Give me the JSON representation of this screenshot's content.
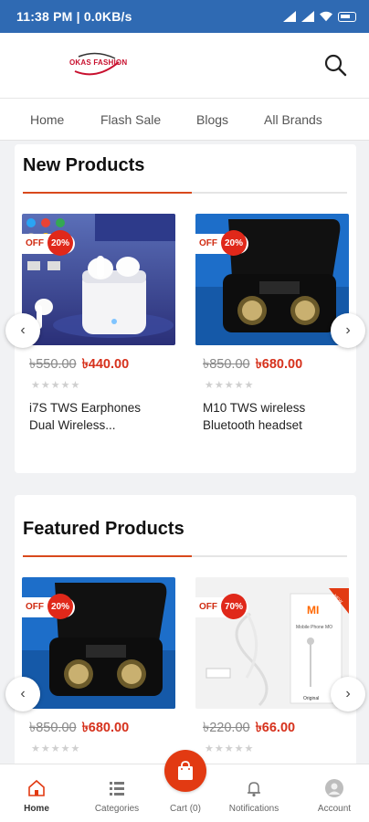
{
  "status_bar": {
    "time": "11:38 PM | 0.0KB/s"
  },
  "header": {
    "logo_text": "OKAS FASHION",
    "search_icon": "search-icon"
  },
  "nav_tabs": [
    {
      "label": "Home"
    },
    {
      "label": "Flash Sale"
    },
    {
      "label": "Blogs"
    },
    {
      "label": "All Brands"
    }
  ],
  "new_products": {
    "title": "New Products",
    "items": [
      {
        "off_label": "OFF",
        "discount": "20%",
        "old_price": "৳550.00",
        "new_price": "৳440.00",
        "rating": 0,
        "name": "i7S TWS Earphones Dual Wireless..."
      },
      {
        "off_label": "OFF",
        "discount": "20%",
        "old_price": "৳850.00",
        "new_price": "৳680.00",
        "rating": 0,
        "name": "M10 TWS wireless Bluetooth headset"
      }
    ]
  },
  "featured_products": {
    "title": "Featured Products",
    "items": [
      {
        "off_label": "OFF",
        "discount": "20%",
        "old_price": "৳850.00",
        "new_price": "৳680.00",
        "rating": 0
      },
      {
        "off_label": "OFF",
        "discount": "70%",
        "old_price": "৳220.00",
        "new_price": "৳66.00",
        "rating": 0,
        "image_texts": {
          "brand": "MI",
          "label": "Mobile Phone MO",
          "badge": "NEW",
          "note": "Original"
        }
      }
    ]
  },
  "bottom_nav": [
    {
      "label": "Home",
      "icon": "home-icon",
      "active": true
    },
    {
      "label": "Categories",
      "icon": "list-icon",
      "active": false
    },
    {
      "label": "Cart (0)",
      "icon": "shopping-bag-icon",
      "active": false
    },
    {
      "label": "Notifications",
      "icon": "bell-icon",
      "active": false
    },
    {
      "label": "Account",
      "icon": "user-avatar-icon",
      "active": false
    }
  ],
  "colors": {
    "status_bar": "#2f6ab3",
    "accent": "#d9491c",
    "price": "#d6311c",
    "cart_fab": "#e23a12"
  }
}
